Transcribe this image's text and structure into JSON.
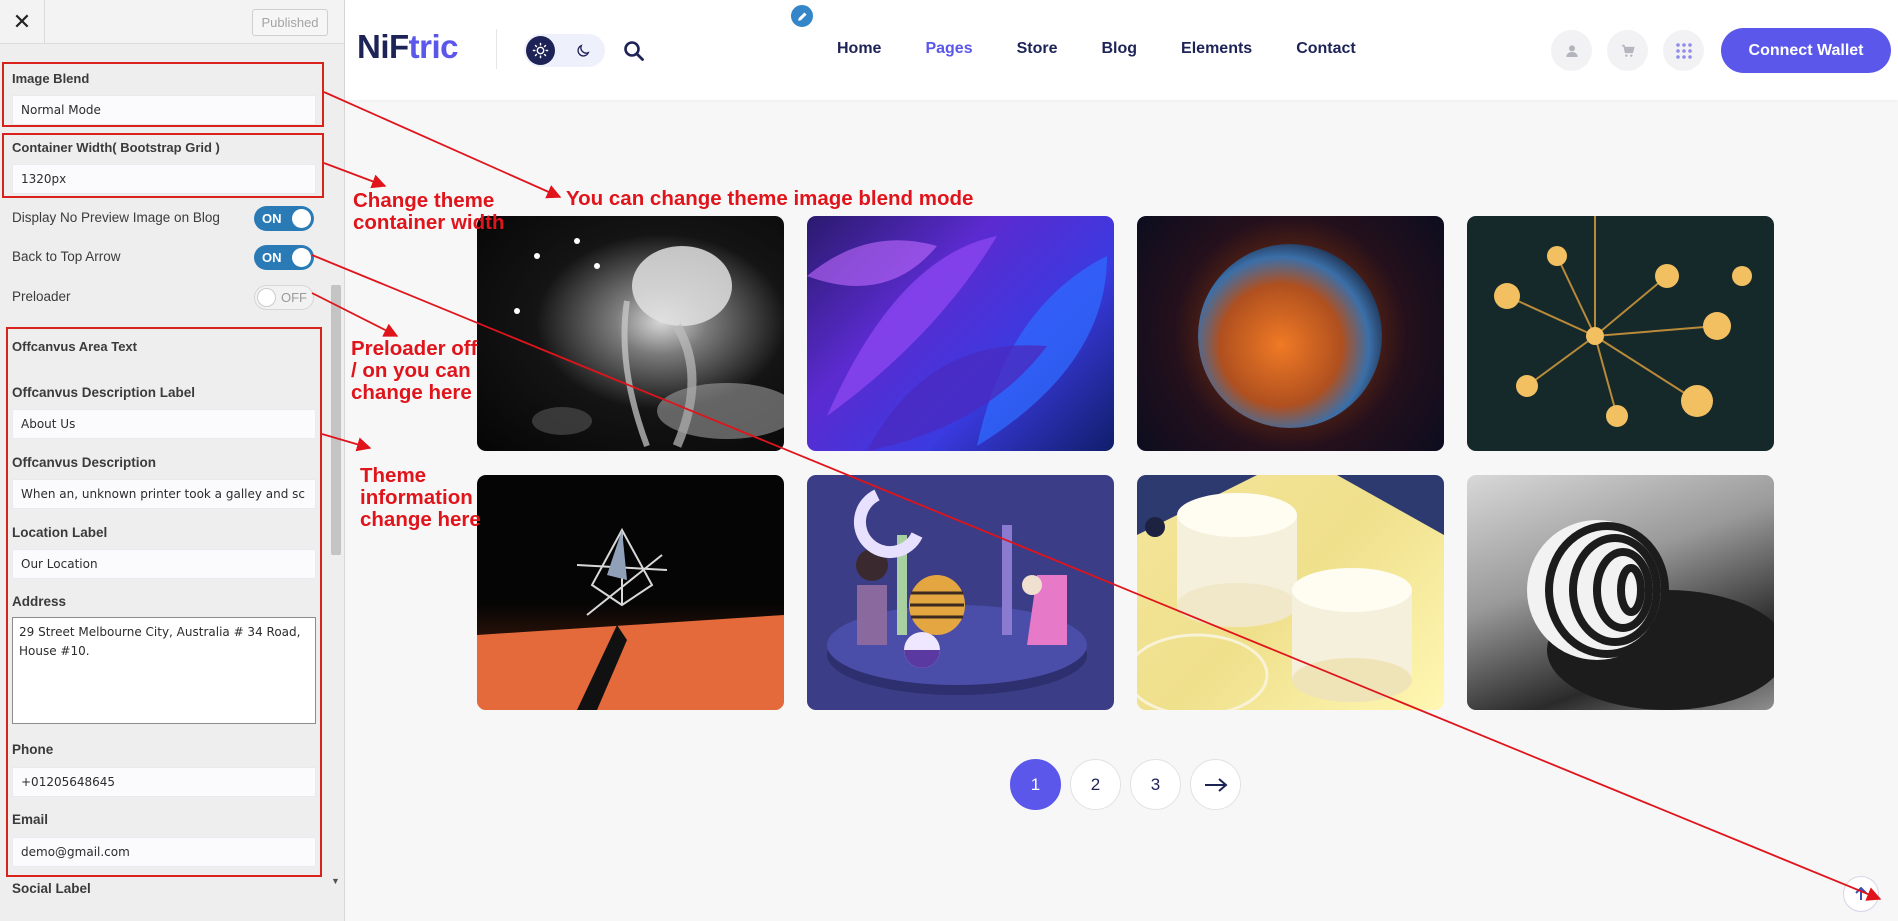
{
  "sidebar": {
    "close_glyph": "✕",
    "published_label": "Published",
    "image_blend": {
      "label": "Image Blend",
      "value": "Normal Mode"
    },
    "container_width": {
      "label": "Container Width( Bootstrap Grid )",
      "value": "1320px"
    },
    "toggles": [
      {
        "label": "Display No Preview Image on Blog",
        "state": "ON"
      },
      {
        "label": "Back to Top Arrow",
        "state": "ON"
      },
      {
        "label": "Preloader",
        "state": "OFF"
      }
    ],
    "offcanvas_heading": "Offcanvus Area Text",
    "desc_label": {
      "label": "Offcanvus Description Label",
      "value": "About Us"
    },
    "description": {
      "label": "Offcanvus Description",
      "value": "When an, unknown printer took a galley and sc"
    },
    "location_label": {
      "label": "Location Label",
      "value": "Our Location"
    },
    "address": {
      "label": "Address",
      "value": "29 Street Melbourne City, Australia # 34 Road, House #10."
    },
    "phone": {
      "label": "Phone",
      "value": "+01205648645"
    },
    "email": {
      "label": "Email",
      "value": "demo@gmail.com"
    },
    "social_label": "Social Label"
  },
  "header": {
    "logo_main": "NiF",
    "logo_accent": "tric",
    "nav": [
      "Home",
      "Pages",
      "Store",
      "Blog",
      "Elements",
      "Contact"
    ],
    "active_nav": "Pages",
    "connect_label": "Connect Wallet"
  },
  "pagination": {
    "pages": [
      "1",
      "2",
      "3"
    ],
    "active": "1",
    "next_glyph": "→"
  },
  "annotations": {
    "blend": "You can change theme image blend mode",
    "container": "Change theme container width",
    "preloader": "Preloader off / on you can change here",
    "theme_info": "Theme information change here"
  },
  "colors": {
    "accent": "#5a57ea",
    "navy": "#1e2357",
    "annotation_red": "#e0141b",
    "toggle_on": "#2a7bb5"
  }
}
